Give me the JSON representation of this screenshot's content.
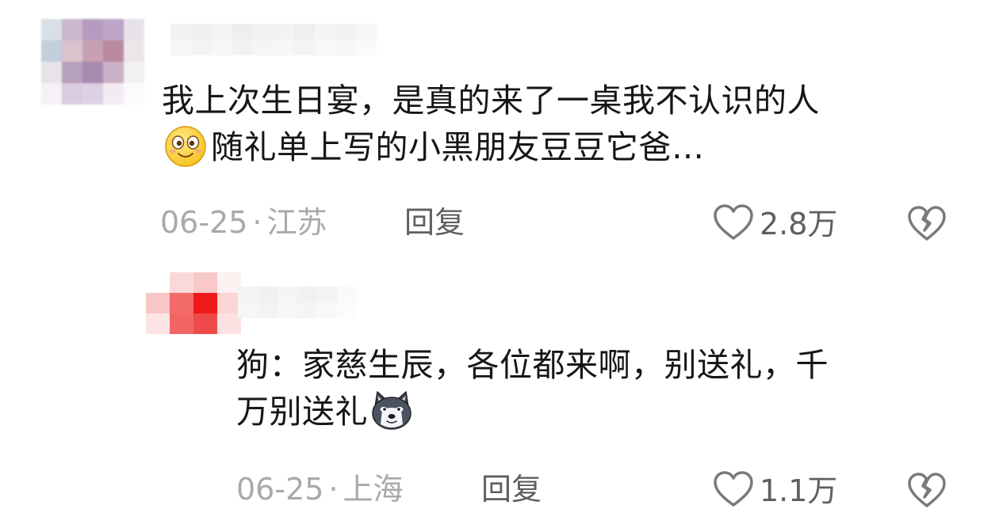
{
  "comments": [
    {
      "text_line_1": "我上次生日宴，是真的来了一桌我不认识的人",
      "text_line_2": "随礼单上写的小黑朋友豆豆它爸…",
      "inline_emoji": "smiling-face-emoji",
      "date": "06-25",
      "separator": "·",
      "location": "江苏",
      "reply_label": "回复",
      "like_count": "2.8万",
      "like_icon": "heart-outline-icon",
      "dislike_icon": "broken-heart-icon"
    },
    {
      "text_line_1": "狗：家慈生辰，各位都来啊，别送礼，千",
      "text_line_2": "万别送礼",
      "inline_emoji": "dog-face-emoji",
      "date": "06-25",
      "separator": "·",
      "location": "上海",
      "reply_label": "回复",
      "like_count": "1.1万",
      "like_icon": "heart-outline-icon",
      "dislike_icon": "broken-heart-icon"
    }
  ],
  "colors": {
    "text": "#161616",
    "meta_text": "#a9a9a9",
    "action_text": "#5f5f5f",
    "icon_stroke": "#7a7a7a"
  }
}
